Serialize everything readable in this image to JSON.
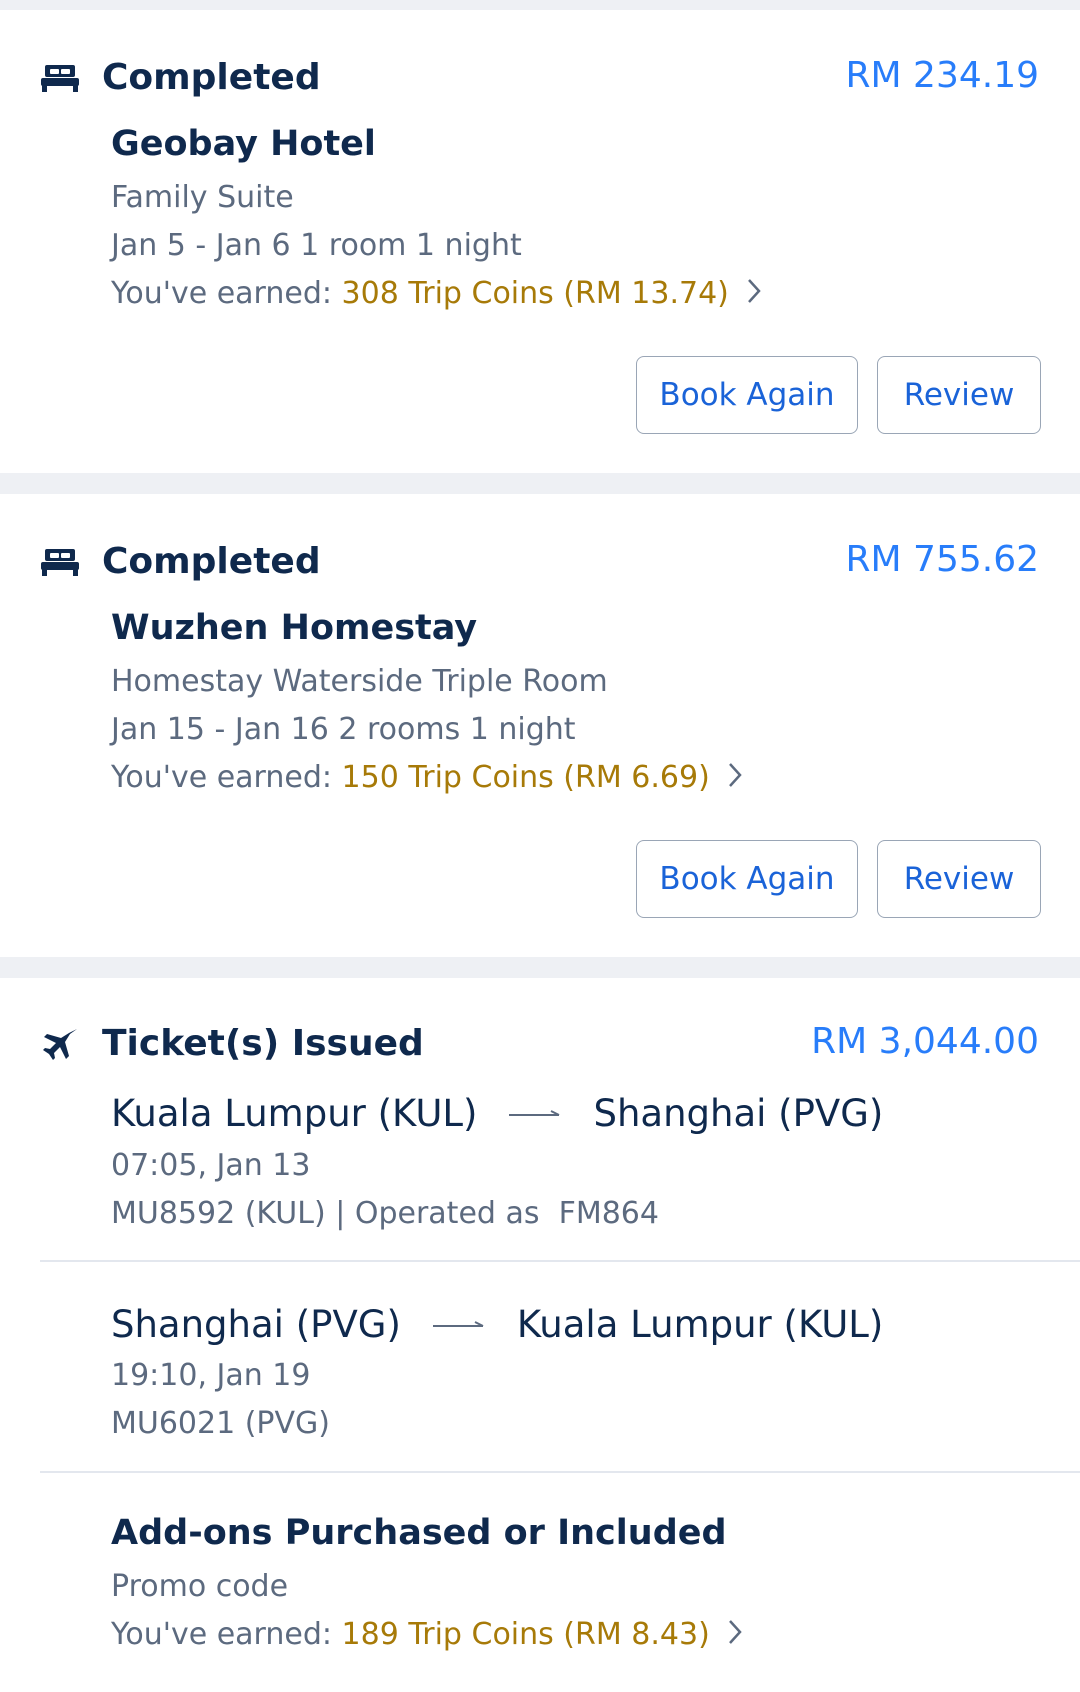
{
  "orders": [
    {
      "status": "Completed",
      "price": "RM 234.19",
      "name": "Geobay Hotel",
      "room": "Family Suite",
      "dates": "Jan 5 - Jan 6 1 room 1 night",
      "earned_label": "You've earned:",
      "coins": "308 Trip Coins (RM 13.74)",
      "book_again_label": "Book Again",
      "review_label": "Review",
      "icon": "bed-icon"
    },
    {
      "status": "Completed",
      "price": "RM 755.62",
      "name": "Wuzhen Homestay",
      "room": "Homestay Waterside Triple Room",
      "dates": "Jan 15 - Jan 16 2 rooms 1 night",
      "earned_label": "You've earned:",
      "coins": "150 Trip Coins (RM 6.69)",
      "book_again_label": "Book Again",
      "review_label": "Review",
      "icon": "bed-icon"
    }
  ],
  "flight": {
    "status": "Ticket(s) Issued",
    "price": "RM 3,044.00",
    "icon": "plane-icon",
    "legs": [
      {
        "from": "Kuala Lumpur (KUL)",
        "to": "Shanghai (PVG)",
        "time": "07:05, Jan 13",
        "detail": "MU8592 (KUL) | Operated as  FM864"
      },
      {
        "from": "Shanghai (PVG)",
        "to": "Kuala Lumpur (KUL)",
        "time": "19:10, Jan 19",
        "detail": "MU6021 (PVG)"
      }
    ],
    "addons": {
      "title": "Add-ons Purchased or Included",
      "item": "Promo code",
      "earned_label": "You've earned:",
      "coins": "189 Trip Coins (RM 8.43)"
    }
  },
  "colors": {
    "price": "#287dfa",
    "coins": "#a77a08",
    "text": "#0f294d",
    "sub": "#5c6a7f"
  }
}
